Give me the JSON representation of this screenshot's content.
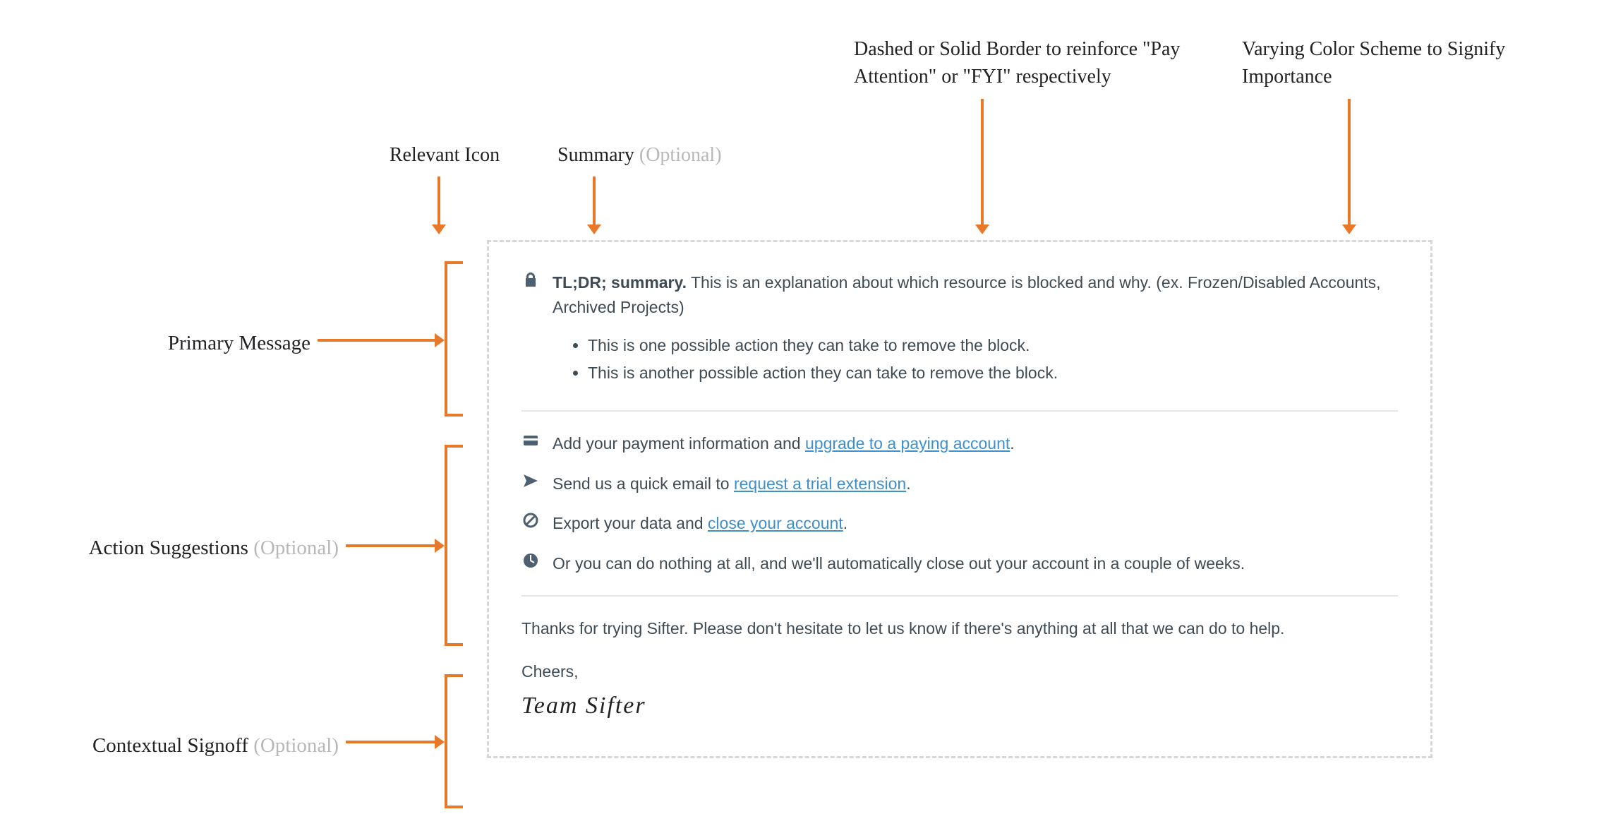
{
  "annotations": {
    "icon": "Relevant Icon",
    "summary": "Summary",
    "summary_opt": " (Optional)",
    "border": "Dashed or Solid Border to reinforce \"Pay Attention\" or \"FYI\" respectively",
    "color": "Varying Color Scheme to Signify Importance",
    "primary": "Primary Message",
    "actions": "Action Suggestions",
    "actions_opt": " (Optional)",
    "signoff": "Contextual Signoff",
    "signoff_opt": " (Optional)"
  },
  "card": {
    "summary_bold": "TL;DR; summary.",
    "summary_rest": " This is an explanation about which resource is blocked and why. (ex. Frozen/Disabled Accounts, Archived Projects)",
    "bullets": [
      "This is one possible action they can take to remove the block.",
      "This is another possible action they can take to remove the block."
    ],
    "actions": [
      {
        "icon": "card",
        "pre": "Add your payment information and ",
        "link": "upgrade to a paying account",
        "post": "."
      },
      {
        "icon": "send",
        "pre": "Send us a quick email to ",
        "link": "request a trial extension",
        "post": "."
      },
      {
        "icon": "block",
        "pre": "Export your data and ",
        "link": "close your account",
        "post": "."
      },
      {
        "icon": "clock",
        "pre": "Or you can do nothing at all, and we'll automatically close out your account in a couple of weeks.",
        "link": "",
        "post": ""
      }
    ],
    "signoff_msg": "Thanks for trying Sifter. Please don't hesitate to let us know if there's anything at all that we can do to help.",
    "cheers": "Cheers,",
    "team": "Team Sifter"
  },
  "colors": {
    "accent": "#e8792b",
    "link": "#3e8fcc",
    "body": "#3f4b54",
    "border": "#d7d7d7"
  }
}
